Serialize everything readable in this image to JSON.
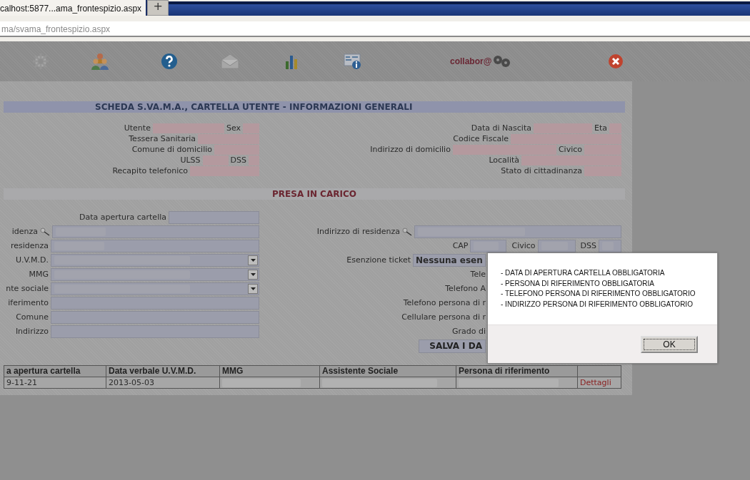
{
  "browser": {
    "tab_title": "calhost:5877...ama_frontespizio.aspx",
    "new_tab": "+",
    "address": "ma/svama_frontespizio.aspx"
  },
  "toolbar": {
    "logo_text": "collabor@"
  },
  "header": {
    "title": "SCHEDA S.VA.M.A., CARTELLA UTENTE - INFORMAZIONI GENERALI"
  },
  "info_rows": [
    {
      "left": [
        "Utente",
        "Sex"
      ],
      "right": [
        "Data di Nascita",
        "Eta"
      ]
    },
    {
      "left": [
        "Tessera Sanitaria"
      ],
      "right": [
        "Codice Fiscale"
      ]
    },
    {
      "left": [
        "Comune di domicilio"
      ],
      "right": [
        "Indirizzo di domicilio",
        "Civico"
      ]
    },
    {
      "left": [
        "ULSS",
        "DSS"
      ],
      "right": [
        "Località"
      ]
    },
    {
      "left": [
        "Recapito telefonico"
      ],
      "right": [
        "Stato di cittadinanza"
      ]
    }
  ],
  "section": {
    "title": "PRESA IN CARICO"
  },
  "form_rows": [
    {
      "left": {
        "label": "Data apertura cartella",
        "kind": "input"
      },
      "right": {
        "kind": "none"
      }
    },
    {
      "left": {
        "label": "idenza",
        "kind": "search-input"
      },
      "right": {
        "kind": "search-input",
        "label": "Indirizzo di residenza"
      }
    },
    {
      "left": {
        "label": "residenza",
        "kind": "redacted-input"
      },
      "right": {
        "kind": "multi",
        "labels": [
          "CAP",
          "Civico",
          "DSS"
        ]
      }
    },
    {
      "left": {
        "label": "U.V.M.D.",
        "kind": "redacted-select"
      },
      "right": {
        "kind": "select",
        "label": "Esenzione ticket",
        "value": "Nessuna esen"
      }
    },
    {
      "left": {
        "label": "MMG",
        "kind": "redacted-select"
      },
      "right": {
        "kind": "label",
        "label": "Tele"
      }
    },
    {
      "left": {
        "label": "nte sociale",
        "kind": "redacted-select"
      },
      "right": {
        "kind": "label",
        "label": "Telefono A"
      }
    },
    {
      "left": {
        "label": "iferimento",
        "kind": "input"
      },
      "right": {
        "kind": "label",
        "label": "Telefono persona di r"
      }
    },
    {
      "left": {
        "label": "Comune",
        "kind": "input"
      },
      "right": {
        "kind": "label",
        "label": "Cellulare persona di r"
      }
    },
    {
      "left": {
        "label": "Indirizzo",
        "kind": "input"
      },
      "right": {
        "kind": "label",
        "label": "Grado di"
      }
    },
    {
      "left": {
        "kind": "none"
      },
      "right": {
        "kind": "button",
        "label": "SALVA I DA"
      }
    }
  ],
  "table": {
    "columns": [
      "a apertura cartella",
      "Data verbale U.V.M.D.",
      "MMG",
      "Assistente Sociale",
      "Persona di riferimento"
    ],
    "rows": [
      [
        {
          "kind": "text",
          "text": "9-11-21"
        },
        {
          "kind": "text",
          "text": "2013-05-03"
        },
        {
          "kind": "redacted"
        },
        {
          "kind": "redacted"
        },
        {
          "kind": "redacted"
        },
        {
          "kind": "link",
          "text": "Dettagli"
        }
      ]
    ]
  },
  "dialog": {
    "messages": [
      "- DATA DI APERTURA CARTELLA OBBLIGATORIA",
      "- PERSONA DI RIFERIMENTO OBBLIGATORIA",
      "- TELEFONO PERSONA DI RIFERIMENTO OBBLIGATORIO",
      "- INDIRIZZO PERSONA DI RIFERIMENTO OBBLIGATORIO"
    ],
    "ok": "OK"
  }
}
